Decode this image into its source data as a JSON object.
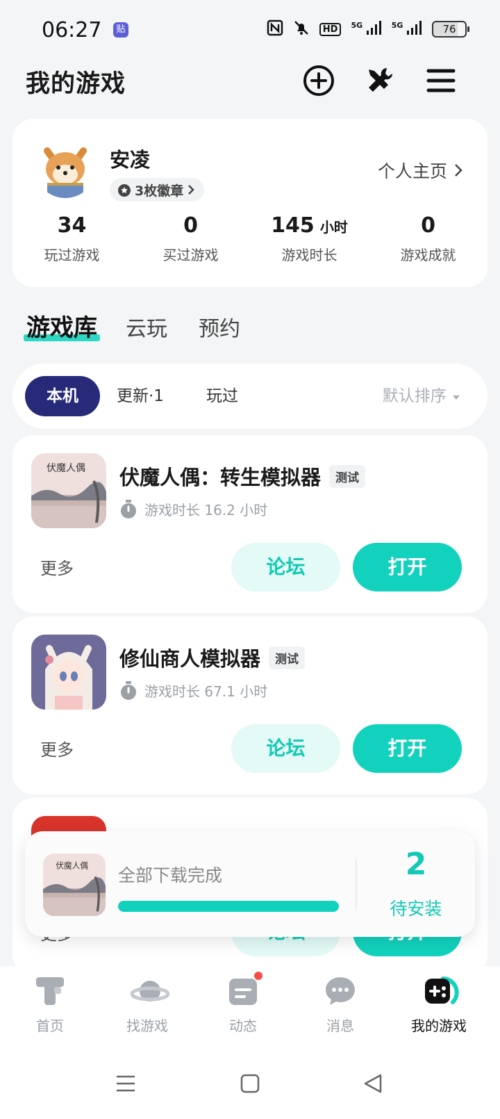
{
  "status_bar": {
    "time": "06:27",
    "app_badge": "贴",
    "hd_label": "HD",
    "signal_1": "5G",
    "signal_2": "5G",
    "battery": "76"
  },
  "header": {
    "title": "我的游戏",
    "icons": [
      "add-circle-icon",
      "tools-icon",
      "menu-icon"
    ]
  },
  "profile": {
    "name": "安凌",
    "badges_label": "3枚徽章",
    "home_link": "个人主页",
    "stats": [
      {
        "value": "34",
        "unit": "",
        "label": "玩过游戏"
      },
      {
        "value": "0",
        "unit": "",
        "label": "买过游戏"
      },
      {
        "value": "145",
        "unit": "小时",
        "label": "游戏时长"
      },
      {
        "value": "0",
        "unit": "",
        "label": "游戏成就"
      }
    ]
  },
  "tabs": [
    {
      "label": "游戏库",
      "active": true
    },
    {
      "label": "云玩",
      "active": false
    },
    {
      "label": "预约",
      "active": false
    }
  ],
  "filters": {
    "items": [
      {
        "label": "本机",
        "active": true
      },
      {
        "label": "更新·1",
        "active": false
      },
      {
        "label": "玩过",
        "active": false
      }
    ],
    "sort": "默认排序"
  },
  "games": [
    {
      "title": "伏魔人偶：转生模拟器",
      "tag": "测试",
      "playtime": "游戏时长 16.2 小时",
      "more": "更多",
      "forum": "论坛",
      "open": "打开"
    },
    {
      "title": "修仙商人模拟器",
      "tag": "测试",
      "playtime": "游戏时长 67.1 小时",
      "more": "更多",
      "forum": "论坛",
      "open": "打开"
    },
    {
      "title": "",
      "tag": "",
      "playtime": "",
      "more": "更多",
      "forum": "论坛",
      "open": "打开"
    }
  ],
  "download": {
    "status": "全部下载完成",
    "progress": 1.0,
    "pending_count": "2",
    "pending_label": "待安装",
    "icon_text": "伏魔人偶"
  },
  "game_icon_text": "伏魔人偶",
  "bottom_nav": [
    {
      "label": "首页",
      "icon": "home-icon",
      "active": false
    },
    {
      "label": "找游戏",
      "icon": "planet-icon",
      "active": false
    },
    {
      "label": "动态",
      "icon": "feed-icon",
      "active": false,
      "dot": true
    },
    {
      "label": "消息",
      "icon": "chat-icon",
      "active": false
    },
    {
      "label": "我的游戏",
      "icon": "gamepad-icon",
      "active": true
    }
  ],
  "colors": {
    "accent": "#12d2bd",
    "accent_light": "#e3faf7",
    "filter_active": "#262a78",
    "background": "#f3f5f7"
  }
}
